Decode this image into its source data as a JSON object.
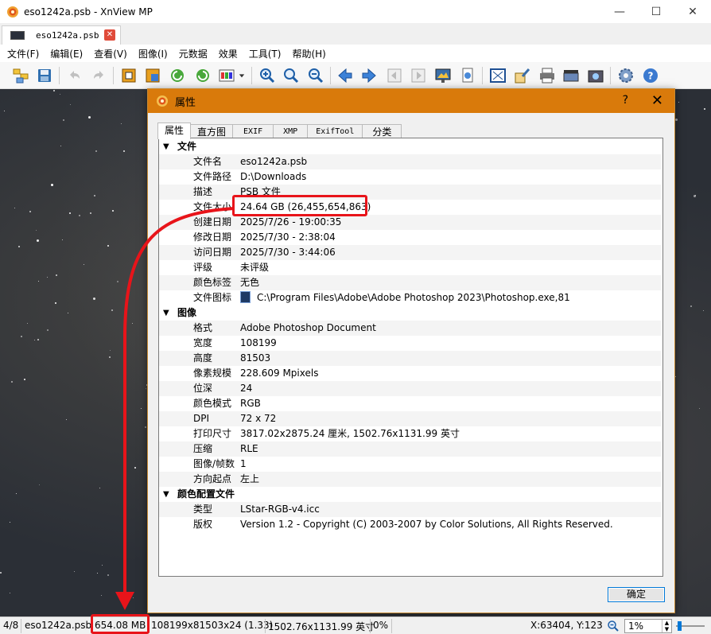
{
  "window": {
    "title": "eso1242a.psb - XnView MP",
    "minimize": "—",
    "maximize": "☐",
    "close": "✕"
  },
  "tab": {
    "label": "eso1242a.psb",
    "close": "✕"
  },
  "menu": [
    "文件(F)",
    "编辑(E)",
    "查看(V)",
    "图像(I)",
    "元数据",
    "效果",
    "工具(T)",
    "帮助(H)"
  ],
  "dialog": {
    "title": "属性",
    "help": "?",
    "close": "✕",
    "tabs": [
      "属性",
      "直方图",
      "EXIF",
      "XMP",
      "ExifTool",
      "分类"
    ],
    "ok_label": "确定",
    "sections": [
      {
        "label": "文件",
        "rows": [
          {
            "key": "文件名",
            "value": "eso1242a.psb"
          },
          {
            "key": "文件路径",
            "value": "D:\\Downloads"
          },
          {
            "key": "描述",
            "value": "PSB 文件"
          },
          {
            "key": "文件大小",
            "value": "24.64 GB (26,455,654,863)"
          },
          {
            "key": "创建日期",
            "value": "2025/7/26 - 19:00:35"
          },
          {
            "key": "修改日期",
            "value": "2025/7/30 - 2:38:04"
          },
          {
            "key": "访问日期",
            "value": "2025/7/30 - 3:44:06"
          },
          {
            "key": "评级",
            "value": "未评级"
          },
          {
            "key": "颜色标签",
            "value": "无色"
          },
          {
            "key": "文件图标",
            "value": "C:\\Program Files\\Adobe\\Adobe Photoshop 2023\\Photoshop.exe,81"
          }
        ]
      },
      {
        "label": "图像",
        "rows": [
          {
            "key": "格式",
            "value": "Adobe Photoshop Document"
          },
          {
            "key": "宽度",
            "value": "108199"
          },
          {
            "key": "高度",
            "value": "81503"
          },
          {
            "key": "像素规模",
            "value": "228.609 Mpixels"
          },
          {
            "key": "位深",
            "value": "24"
          },
          {
            "key": "颜色模式",
            "value": "RGB"
          },
          {
            "key": "DPI",
            "value": "72 x 72"
          },
          {
            "key": "打印尺寸",
            "value": "3817.02x2875.24 厘米, 1502.76x1131.99 英寸"
          },
          {
            "key": "压缩",
            "value": "RLE"
          },
          {
            "key": "图像/帧数",
            "value": "1"
          },
          {
            "key": "方向起点",
            "value": "左上"
          }
        ]
      },
      {
        "label": "颜色配置文件",
        "rows": [
          {
            "key": "类型",
            "value": "LStar-RGB-v4.icc"
          },
          {
            "key": "版权",
            "value": "Version 1.2 - Copyright (C) 2003-2007 by Color Solutions, All Rights Reserved."
          }
        ]
      }
    ]
  },
  "status": {
    "index": "4/8",
    "filename": "eso1242a.psb",
    "memory": "654.08 MB",
    "dimensions": "108199x81503x24 (1.33)",
    "print_size": "1502.76x1131.99 英寸",
    "percent": "0%",
    "coords": "X:63404, Y:123",
    "zoom": "1%"
  },
  "colors": {
    "dialog_title_bg": "#d97a0b",
    "annotation_red": "#e8141a"
  }
}
